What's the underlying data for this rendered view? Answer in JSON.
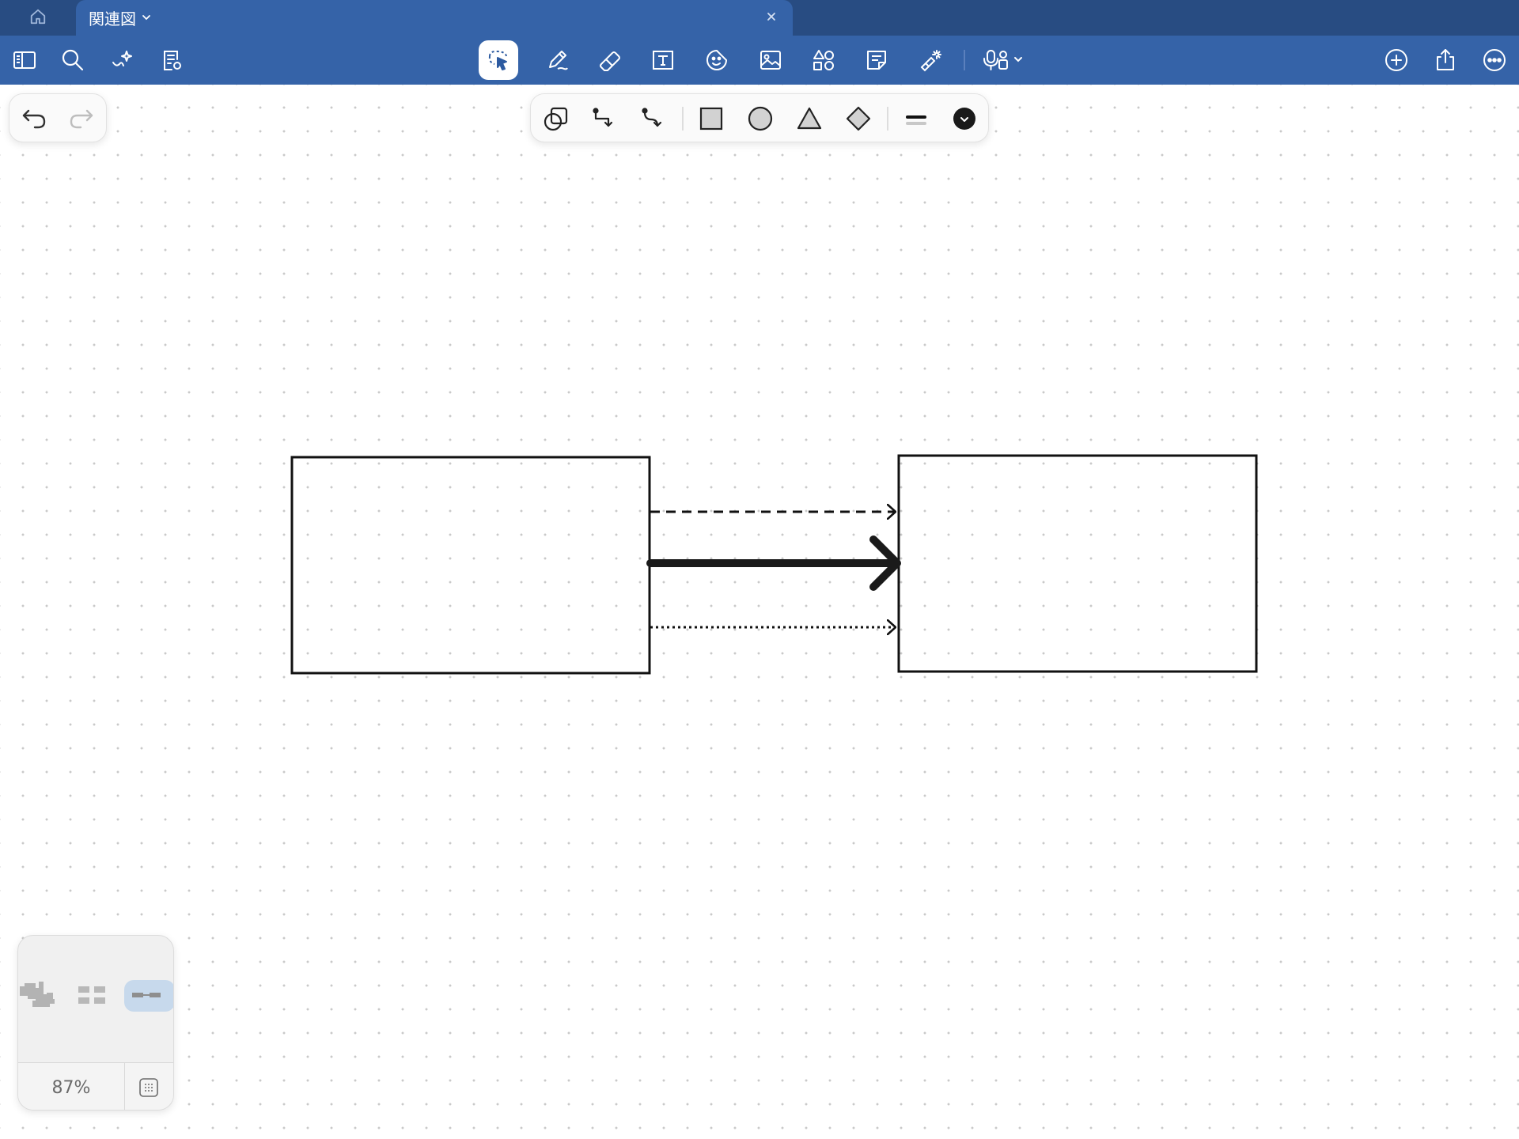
{
  "titlebar": {
    "home_icon": "house-icon",
    "tab": {
      "title": "関連図",
      "chevron_icon": "chevron-down-icon",
      "close_icon": "close-icon"
    }
  },
  "toolbar": {
    "left": [
      "sidebar-icon",
      "search-icon",
      "ai-sparkle-icon",
      "page-settings-icon"
    ],
    "center": [
      "lasso-select-icon",
      "pen-icon",
      "eraser-icon",
      "text-box-icon",
      "sticker-icon",
      "image-icon",
      "shapes-icon",
      "sticky-note-icon",
      "laser-pointer-icon",
      "microphone-icon"
    ],
    "right": [
      "add-page-icon",
      "share-icon",
      "more-icon"
    ],
    "active_tool": "lasso-select-icon"
  },
  "undo_palette": [
    "undo-icon",
    "redo-icon"
  ],
  "shape_palette": {
    "tools": [
      "shape-recognition-icon",
      "elbow-connector-icon",
      "curved-connector-icon",
      "rectangle-icon",
      "circle-icon",
      "triangle-icon",
      "diamond-icon",
      "line-weight-icon",
      "color-picker-icon"
    ],
    "current_color": "#1a1a1a"
  },
  "diagram": {
    "nodes": [
      {
        "id": "left-box",
        "label": ""
      },
      {
        "id": "right-box",
        "label": ""
      }
    ],
    "edges": [
      {
        "from": "left-box",
        "to": "right-box",
        "style": "dashed",
        "weight": "thin"
      },
      {
        "from": "left-box",
        "to": "right-box",
        "style": "solid",
        "weight": "thick"
      },
      {
        "from": "left-box",
        "to": "right-box",
        "style": "dotted",
        "weight": "thin"
      }
    ]
  },
  "minimap": {
    "zoom": "87%",
    "grid_icon": "grid-toggle-icon"
  },
  "colors": {
    "titlebar_bg": "#284c82",
    "toolbar_bg": "#3563a8",
    "canvas_bg": "#ffffff",
    "stroke": "#111111"
  }
}
